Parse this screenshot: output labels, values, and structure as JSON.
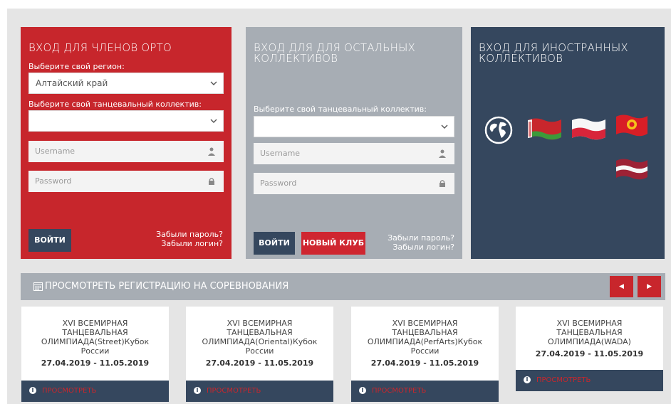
{
  "orto_panel": {
    "title": "ВХОД ДЛЯ ЧЛЕНОВ ОРТО",
    "region_label": "Выберите свой регион:",
    "region_value": "Алтайский край",
    "collective_label": "Выберите свой танцевальный коллектив:",
    "collective_value": "",
    "username_placeholder": "Username",
    "password_placeholder": "Password",
    "login_button": "ВОЙТИ",
    "forgot_password": "Забыли пароль?",
    "forgot_login": "Забыли логин?"
  },
  "other_panel": {
    "title": "ВХОД ДЛЯ ДЛЯ ОСТАЛЬНЫХ КОЛЛЕКТИВОВ",
    "collective_label": "Выберите свой танцевальный коллектив:",
    "collective_value": "",
    "username_placeholder": "Username",
    "password_placeholder": "Password",
    "login_button": "ВОЙТИ",
    "new_club_button": "НОВЫЙ КЛУБ",
    "forgot_password": "Забыли пароль?",
    "forgot_login": "Забыли логин?"
  },
  "foreign_panel": {
    "title": "ВХОД ДЛЯ ИНОСТРАННЫХ КОЛЛЕКТИВОВ",
    "flags": [
      "globe-icon",
      "belarus-flag",
      "poland-flag",
      "kyrgyzstan-flag",
      "latvia-flag"
    ]
  },
  "registration_bar": {
    "label": "ПРОСМОТРЕТЬ РЕГИСТРАЦИЮ НА СОРЕВНОВАНИЯ",
    "prev_glyph": "◀",
    "next_glyph": "▶"
  },
  "cards": [
    {
      "title": "XVI ВСЕМИРНАЯ ТАНЦЕВАЛЬНАЯ ОЛИМПИАДА(Street)Кубок России",
      "dates": "27.04.2019 - 11.05.2019",
      "action": "ПРОСМОТРЕТЬ"
    },
    {
      "title": "XVI ВСЕМИРНАЯ ТАНЦЕВАЛЬНАЯ ОЛИМПИАДА(Oriental)Кубок России",
      "dates": "27.04.2019 - 11.05.2019",
      "action": "ПРОСМОТРЕТЬ"
    },
    {
      "title": "XVI ВСЕМИРНАЯ ТАНЦЕВАЛЬНАЯ ОЛИМПИАДА(PerfArts)Кубок России",
      "dates": "27.04.2019 - 11.05.2019",
      "action": "ПРОСМОТРЕТЬ"
    },
    {
      "title": "XVI ВСЕМИРНАЯ ТАНЦЕВАЛЬНАЯ ОЛИМПИАДА(WADA)",
      "dates": "27.04.2019 - 11.05.2019",
      "action": "ПРОСМОТРЕТЬ"
    }
  ],
  "colors": {
    "red": "#c7262c",
    "gray": "#a7adb4",
    "navy": "#35475e"
  }
}
